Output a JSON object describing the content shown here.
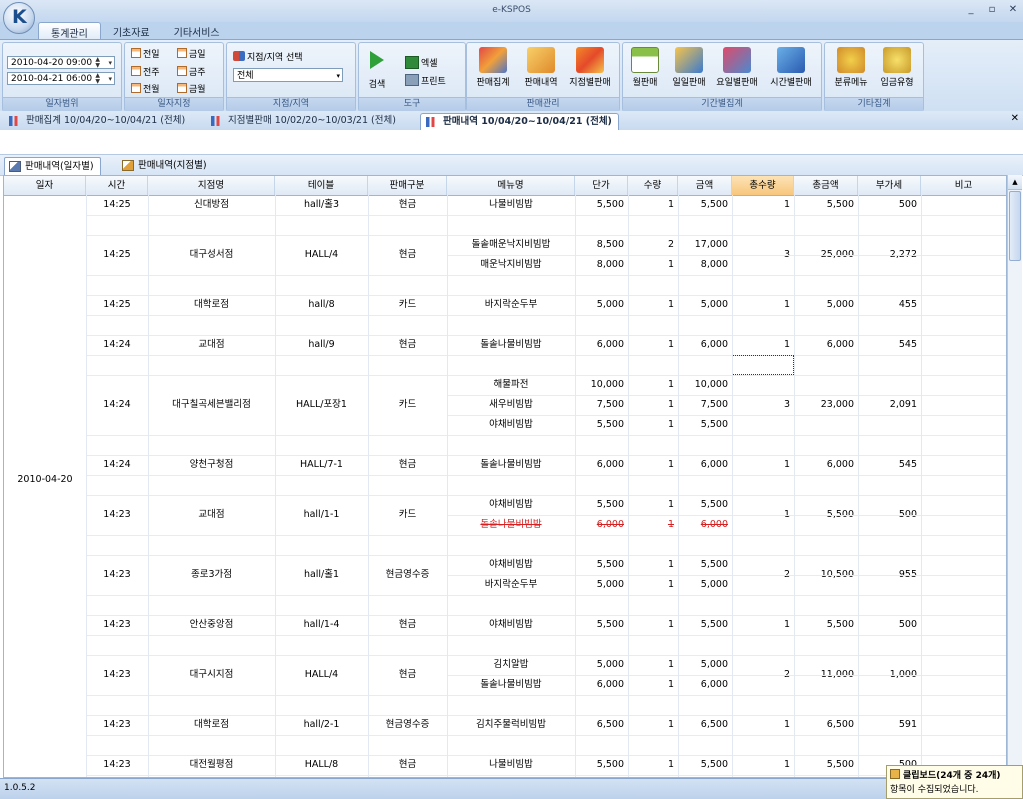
{
  "window": {
    "title": "e-KSPOS",
    "controls": [
      "_",
      "▫",
      "✕"
    ]
  },
  "menu_tabs": [
    {
      "label": "통계관리",
      "active": true
    },
    {
      "label": "기초자료",
      "active": false
    },
    {
      "label": "기타서비스",
      "active": false
    }
  ],
  "ribbon": {
    "date_range": {
      "from": "2010-04-20 09:00",
      "to": "2010-04-21 06:00",
      "group_label": "일자범위"
    },
    "date_presets": {
      "items": [
        "전일",
        "금일",
        "전주",
        "금주",
        "전월",
        "금월"
      ],
      "group_label": "일자지정"
    },
    "store": {
      "select_label": "지점/지역 선택",
      "value": "전체",
      "group_label": "지점/지역"
    },
    "tools": {
      "search": "검색",
      "excel": "엑셀",
      "print": "프린트",
      "group_label": "도구"
    },
    "sales": {
      "items": [
        "판매집계",
        "판매내역",
        "지점별판매"
      ],
      "group_label": "판매관리"
    },
    "period": {
      "items": [
        "월판매",
        "일일판매",
        "요일별판매",
        "시간별판매"
      ],
      "group_label": "기간별집계"
    },
    "other": {
      "items": [
        "분류메뉴",
        "입금유형"
      ],
      "group_label": "기타집계"
    }
  },
  "doc_tabs": [
    {
      "label": "판매집계 10/04/20~10/04/21 (전체)",
      "active": false
    },
    {
      "label": "지점별판매 10/02/20~10/03/21 (전체)",
      "active": false
    },
    {
      "label": "판매내역 10/04/20~10/04/21 (전체)",
      "active": true
    }
  ],
  "sub_tabs": [
    {
      "label": "판매내역(일자별)",
      "active": true
    },
    {
      "label": "판매내역(지점별)",
      "active": false
    }
  ],
  "table": {
    "columns": [
      "일자",
      "시간",
      "지점명",
      "테이블",
      "판매구분",
      "메뉴명",
      "단가",
      "수량",
      "금액",
      "총수량",
      "총금액",
      "부가세",
      "비고"
    ],
    "date_value": "2010-04-20",
    "orders": [
      {
        "time": "14:25",
        "store": "신대방점",
        "table": "hall/홀3",
        "type": "현금",
        "total_qty": "1",
        "total_amount": "5,500",
        "vat": "500",
        "items": [
          {
            "menu": "나물비빔밥",
            "price": "5,500",
            "qty": "1",
            "amount": "5,500"
          }
        ]
      },
      {
        "time": "14:25",
        "store": "대구성서점",
        "table": "HALL/4",
        "type": "현금",
        "total_qty": "3",
        "total_amount": "25,000",
        "vat": "2,272",
        "items": [
          {
            "menu": "돌솥매운낙지비빔밥",
            "price": "8,500",
            "qty": "2",
            "amount": "17,000"
          },
          {
            "menu": "매운낙지비빔밥",
            "price": "8,000",
            "qty": "1",
            "amount": "8,000"
          }
        ]
      },
      {
        "time": "14:25",
        "store": "대학로점",
        "table": "hall/8",
        "type": "카드",
        "total_qty": "1",
        "total_amount": "5,000",
        "vat": "455",
        "items": [
          {
            "menu": "바지락순두부",
            "price": "5,000",
            "qty": "1",
            "amount": "5,000"
          }
        ]
      },
      {
        "time": "14:24",
        "store": "교대점",
        "table": "hall/9",
        "type": "현금",
        "total_qty": "1",
        "total_amount": "6,000",
        "vat": "545",
        "items": [
          {
            "menu": "돌솥나물비빔밥",
            "price": "6,000",
            "qty": "1",
            "amount": "6,000"
          }
        ]
      },
      {
        "time": "14:24",
        "store": "대구칠곡세븐밸리점",
        "table": "HALL/포장1",
        "type": "카드",
        "total_qty": "3",
        "total_amount": "23,000",
        "vat": "2,091",
        "items": [
          {
            "menu": "해물파전",
            "price": "10,000",
            "qty": "1",
            "amount": "10,000"
          },
          {
            "menu": "새우비빔밥",
            "price": "7,500",
            "qty": "1",
            "amount": "7,500"
          },
          {
            "menu": "야채비빔밥",
            "price": "5,500",
            "qty": "1",
            "amount": "5,500"
          }
        ]
      },
      {
        "time": "14:24",
        "store": "양천구청점",
        "table": "HALL/7-1",
        "type": "현금",
        "total_qty": "1",
        "total_amount": "6,000",
        "vat": "545",
        "items": [
          {
            "menu": "돌솥나물비빔밥",
            "price": "6,000",
            "qty": "1",
            "amount": "6,000"
          }
        ]
      },
      {
        "time": "14:23",
        "store": "교대점",
        "table": "hall/1-1",
        "type": "카드",
        "total_qty": "1",
        "total_amount": "5,500",
        "vat": "500",
        "items": [
          {
            "menu": "야채비빔밥",
            "price": "5,500",
            "qty": "1",
            "amount": "5,500"
          },
          {
            "menu": "돌솥나물비빔밥",
            "price": "6,000",
            "qty": "1",
            "amount": "6,000",
            "cancelled": true
          }
        ]
      },
      {
        "time": "14:23",
        "store": "종로3가점",
        "table": "hall/홀1",
        "type": "현금영수증",
        "total_qty": "2",
        "total_amount": "10,500",
        "vat": "955",
        "items": [
          {
            "menu": "야채비빔밥",
            "price": "5,500",
            "qty": "1",
            "amount": "5,500"
          },
          {
            "menu": "바지락순두부",
            "price": "5,000",
            "qty": "1",
            "amount": "5,000"
          }
        ]
      },
      {
        "time": "14:23",
        "store": "안산중앙점",
        "table": "hall/1-4",
        "type": "현금",
        "total_qty": "1",
        "total_amount": "5,500",
        "vat": "500",
        "items": [
          {
            "menu": "야채비빔밥",
            "price": "5,500",
            "qty": "1",
            "amount": "5,500"
          }
        ]
      },
      {
        "time": "14:23",
        "store": "대구시지점",
        "table": "HALL/4",
        "type": "현금",
        "total_qty": "2",
        "total_amount": "11,000",
        "vat": "1,000",
        "items": [
          {
            "menu": "김치알밥",
            "price": "5,000",
            "qty": "1",
            "amount": "5,000"
          },
          {
            "menu": "돌솥나물비빔밥",
            "price": "6,000",
            "qty": "1",
            "amount": "6,000"
          }
        ]
      },
      {
        "time": "14:23",
        "store": "대학로점",
        "table": "hall/2-1",
        "type": "현금영수증",
        "total_qty": "1",
        "total_amount": "6,500",
        "vat": "591",
        "items": [
          {
            "menu": "김치주물럭비빔밥",
            "price": "6,500",
            "qty": "1",
            "amount": "6,500"
          }
        ]
      },
      {
        "time": "14:23",
        "store": "대전월평점",
        "table": "HALL/8",
        "type": "현금",
        "total_qty": "1",
        "total_amount": "5,500",
        "vat": "500",
        "items": [
          {
            "menu": "나물비빔밥",
            "price": "5,500",
            "qty": "1",
            "amount": "5,500"
          }
        ]
      }
    ]
  },
  "status": {
    "version": "1.0.5.2"
  },
  "toast": {
    "title": "클립보드(24개 중 24개)",
    "message": "항목이 수집되었습니다."
  },
  "colors": {
    "accent_header": "#f7c67d",
    "cancelled": "#d42020",
    "ribbon": "#d9e6f5"
  }
}
